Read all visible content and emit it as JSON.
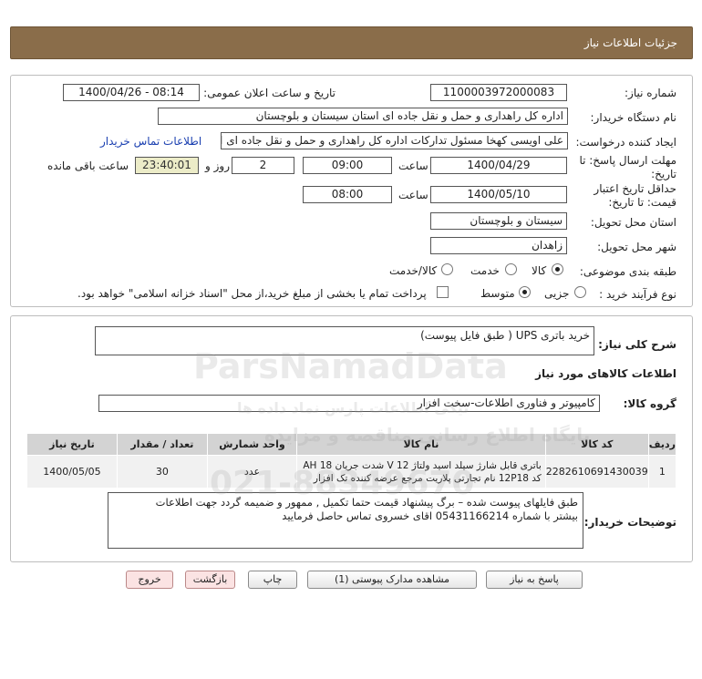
{
  "page": {
    "title": "جزئیات اطلاعات نیاز"
  },
  "form": {
    "need_number": {
      "label": "شماره نیاز:",
      "value": "1100003972000083"
    },
    "announce_datetime": {
      "label": "تاریخ و ساعت اعلان عمومی:",
      "value": "1400/04/26 - 08:14"
    },
    "buyer_org": {
      "label": "نام دستگاه خریدار:",
      "value": "اداره کل راهداری و حمل و نقل جاده ای استان سیستان و بلوچستان"
    },
    "requester": {
      "label": "ایجاد کننده درخواست:",
      "value": "علی اویسی کهخا مسئول تدارکات اداره کل راهداری و حمل و نقل جاده ای است",
      "contact_link": "اطلاعات تماس خریدار"
    },
    "send_deadline": {
      "label": "مهلت ارسال پاسخ: تا تاریخ:",
      "date": "1400/04/29",
      "time_label": "ساعت",
      "time": "09:00",
      "days": "2",
      "days_label": "روز و",
      "remaining": "23:40:01",
      "remaining_label": "ساعت باقی مانده"
    },
    "price_validity": {
      "label": "حداقل تاریخ اعتبار قیمت: تا تاریخ:",
      "date": "1400/05/10",
      "time_label": "ساعت",
      "time": "08:00"
    },
    "delivery_province": {
      "label": "استان محل تحویل:",
      "value": "سیستان و بلوچستان"
    },
    "delivery_city": {
      "label": "شهر محل تحویل:",
      "value": "زاهدان"
    },
    "category": {
      "label": "طبقه بندی موضوعی:",
      "options": [
        "کالا",
        "خدمت",
        "کالا/خدمت"
      ],
      "selected": "کالا"
    },
    "process_type": {
      "label": "نوع فرآیند خرید :",
      "options": [
        "جزیی",
        "متوسط"
      ],
      "selected": "متوسط",
      "treasury_note": "پرداخت تمام یا بخشی از مبلغ خرید،از محل \"اسناد خزانه اسلامی\" خواهد بود."
    }
  },
  "summary": {
    "label": "شرح کلی نیاز:",
    "value": "خرید باتری UPS ( طبق فایل پیوست)"
  },
  "goods_section": {
    "title": "اطلاعات کالاهای مورد نیاز",
    "group_label": "گروه کالا:",
    "group_value": "کامپیوتر و فناوری اطلاعات-سخت افزار",
    "columns": [
      "ردیف",
      "کد کالا",
      "نام کالا",
      "واحد شمارش",
      "تعداد / مقدار",
      "تاریخ نیاز"
    ],
    "rows": [
      {
        "index": "1",
        "code": "2282610691430039",
        "name_line1": "باتری قابل شارژ سیلد اسید ولتاژ 12 V شدت جریان 18 AH",
        "name_line2": "کد 12P18 نام تجارتی پلاریت مرجع عرضه کننده تک افزار",
        "unit": "عدد",
        "qty": "30",
        "date": "1400/05/05"
      }
    ]
  },
  "buyer_notes": {
    "label": "توضیحات خریدار:",
    "line1": "طبق فایلهای پیوست شده – برگ پیشنهاد قیمت حتما تکمیل , ممهور و ضمیمه گردد جهت اطلاعات",
    "line2": "بیشتر با شماره 05431166214 اقای خسروی تماس حاصل فرمایید"
  },
  "buttons": {
    "reply": "پاسخ به نیاز",
    "attachments": "مشاهده مدارک پیوستی (1)",
    "print": "چاپ",
    "back": "بازگشت",
    "exit": "خروج"
  },
  "watermark": {
    "brand": "ParsNamadData",
    "line1": "پایگاه اطلاع رسانی مناقصه و مزایده",
    "line2": "نیکی اطلاعات پارس نماد داده ها",
    "phone": "021-88349670"
  }
}
